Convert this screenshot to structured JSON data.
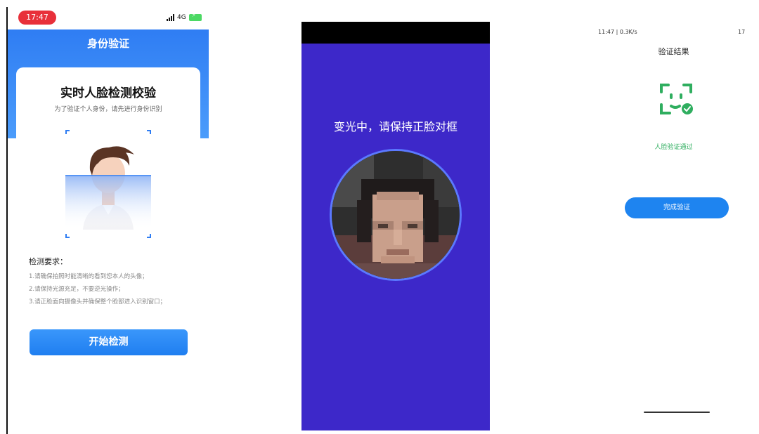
{
  "screen1": {
    "status_time": "17:47",
    "status_network": "4G",
    "header_title": "身份验证",
    "card_title": "实时人脸检测校验",
    "card_subtitle": "为了验证个人身份，请先进行身份识别",
    "requirements_title": "检测要求：",
    "requirements": [
      "1.请确保拍照时能清晰的看到您本人的头像；",
      "2.请保持光源充足，不要逆光操作；",
      "3.请正脸面向摄像头并确保整个脸部进入识别窗口；"
    ],
    "start_button": "开始检测",
    "accent_color": "#2f7df3"
  },
  "screen2": {
    "prompt": "变光中，请保持正脸对框",
    "background_color": "#3d28c9"
  },
  "screen3": {
    "status_left": "11:47 | 0.3K/s",
    "status_right": "17",
    "title": "验证结果",
    "result_text": "人脸验证通过",
    "finish_button": "完成验证",
    "success_color": "#2fae5f"
  }
}
